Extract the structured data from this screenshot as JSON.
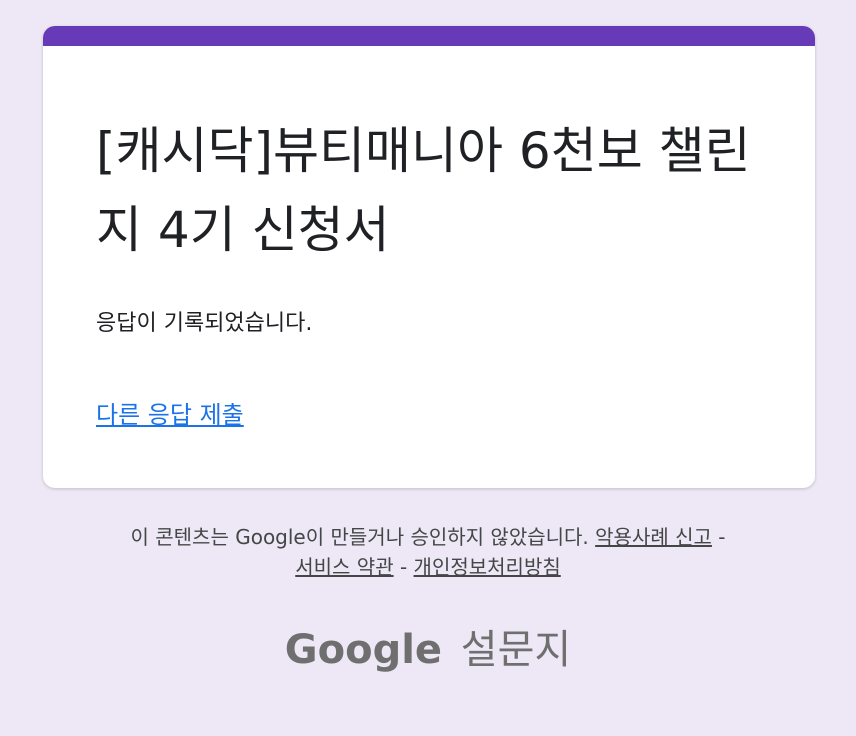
{
  "colors": {
    "page_background": "#ede7f6",
    "accent": "#673ab7",
    "link": "#1a73e8"
  },
  "card": {
    "title": "[캐시닥]뷰티매니아 6천보 챌린지 4기 신청서",
    "message": "응답이 기록되었습니다.",
    "submit_another_label": "다른 응답 제출"
  },
  "footer": {
    "disclaimer_text": "이 콘텐츠는 Google이 만들거나 승인하지 않았습니다.",
    "report_abuse_label": "악용사례 신고",
    "separator": "-",
    "terms_label": "서비스 약관",
    "privacy_label": "개인정보처리방침",
    "brand_google": "Google",
    "brand_product": "설문지"
  }
}
